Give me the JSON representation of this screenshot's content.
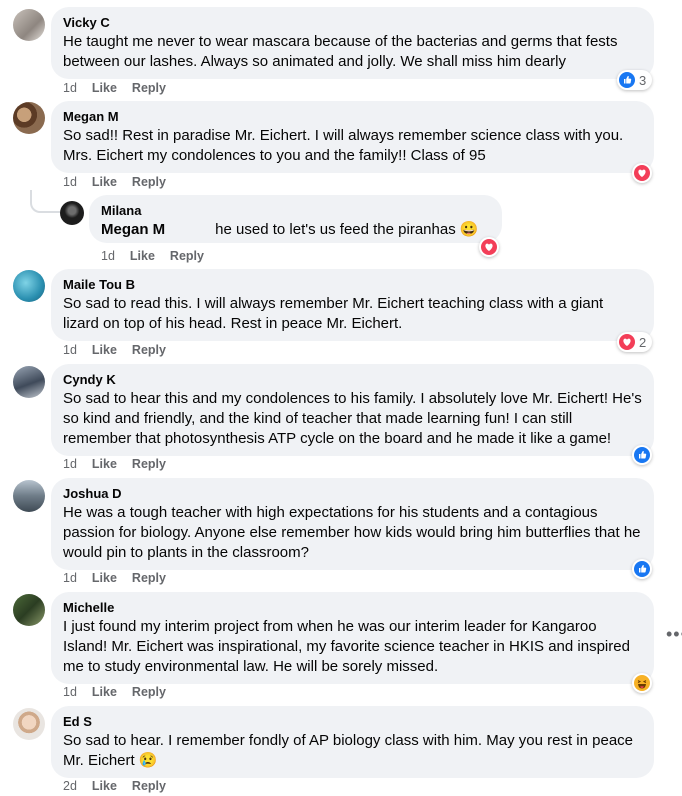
{
  "actions": {
    "like": "Like",
    "reply": "Reply"
  },
  "comments": [
    {
      "author": "Vicky C",
      "text": "He taught me never to wear mascara because of the bacterias and germs that fests between our lashes. Always so animated and jolly. We shall miss him dearly",
      "time": "1d",
      "reaction": {
        "type": "like",
        "count": "3"
      }
    },
    {
      "author": "Megan M",
      "text": "So sad!! Rest in paradise Mr. Eichert. I will always remember science class with you. Mrs. Eichert my condolences to you and the family!! Class of 95",
      "time": "1d",
      "reaction": {
        "type": "love",
        "count": ""
      }
    },
    {
      "author": "Milana",
      "mention": "Megan M",
      "text": "he used to let's us feed the piranhas 😀",
      "time": "1d",
      "reaction": {
        "type": "love",
        "count": ""
      }
    },
    {
      "author": "Maile Tou B",
      "text": "So sad to read this. I will always remember Mr. Eichert teaching class with a giant lizard on top of his head. Rest in peace Mr. Eichert.",
      "time": "1d",
      "reaction": {
        "type": "love",
        "count": "2"
      }
    },
    {
      "author": "Cyndy K",
      "text": "So sad to hear this and my condolences to his family. I absolutely love Mr. Eichert! He's so kind and friendly, and the kind of teacher that made learning fun! I can still remember that photosynthesis ATP cycle on the board and he made it like a game!",
      "time": "1d",
      "reaction": {
        "type": "like",
        "count": ""
      }
    },
    {
      "author": "Joshua D",
      "text": "He was a tough teacher with high expectations for his students and a contagious passion for biology. Anyone else remember how kids would bring him butterflies that he would pin to plants in the classroom?",
      "time": "1d",
      "reaction": {
        "type": "like",
        "count": ""
      }
    },
    {
      "author": "Michelle",
      "text": "I just found my interim project from when he was our interim leader for Kangaroo Island! Mr. Eichert was inspirational, my favorite science teacher in HKIS and inspired me to study environmental law. He will be sorely missed.",
      "time": "1d",
      "reaction": {
        "type": "haha",
        "count": ""
      }
    },
    {
      "author": "Ed S",
      "text": "So sad to hear. I remember fondly of AP biology class with him. May you rest in peace Mr. Eichert 😢",
      "time": "2d",
      "reaction": null
    }
  ],
  "colors": {
    "like": "#1877f2",
    "love": "#f33e58",
    "haha": "#f7b125",
    "bubble": "#f0f2f5",
    "meta": "#65676b"
  },
  "icons": {
    "more": "more-horizontal-icon"
  }
}
